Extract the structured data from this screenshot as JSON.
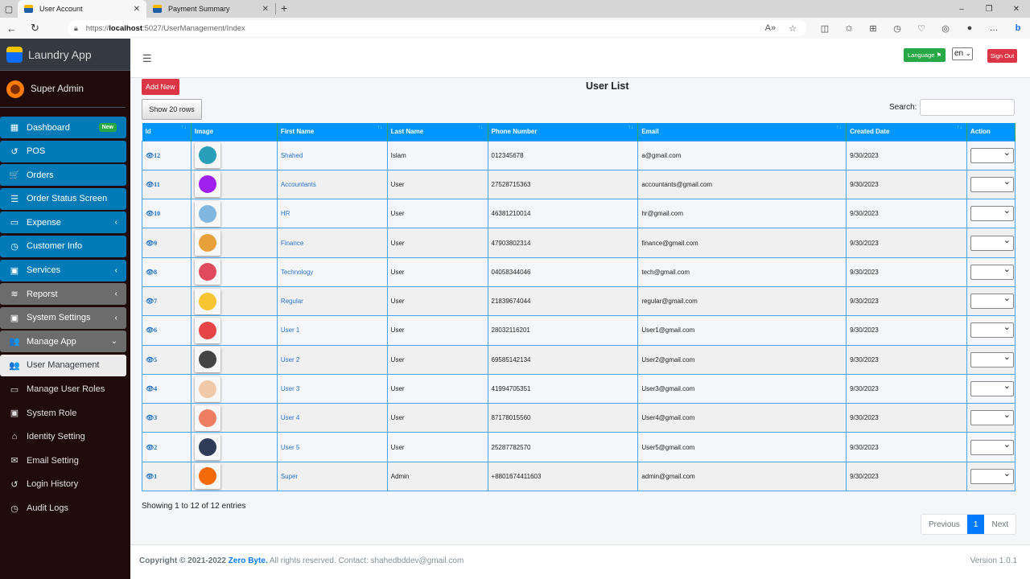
{
  "browser": {
    "tabs": [
      {
        "title": "User Account",
        "active": true
      },
      {
        "title": "Payment Summary",
        "active": false
      }
    ],
    "url_prefix": "https://",
    "url_host": "localhost",
    "url_rest": ":5027/UserManagement/Index"
  },
  "sidebar": {
    "brand": "Laundry App",
    "user": "Super Admin",
    "items": [
      {
        "label": "Dashboard",
        "icon": "th",
        "style": "blue",
        "badge": "New"
      },
      {
        "label": "POS",
        "icon": "↺",
        "style": "blue"
      },
      {
        "label": "Orders",
        "icon": "🛒",
        "style": "blue"
      },
      {
        "label": "Order Status Screen",
        "icon": "☰",
        "style": "blue"
      },
      {
        "label": "Expense",
        "icon": "▭",
        "style": "blue",
        "chevron": "‹"
      },
      {
        "label": "Customer Info",
        "icon": "◷",
        "style": "blue"
      },
      {
        "label": "Services",
        "icon": "▣",
        "style": "blue",
        "chevron": "‹"
      },
      {
        "label": "Reporst",
        "icon": "≋",
        "style": "gray",
        "chevron": "‹"
      },
      {
        "label": "System Settings",
        "icon": "▣",
        "style": "gray",
        "chevron": "‹"
      },
      {
        "label": "Manage App",
        "icon": "👥",
        "style": "gray",
        "chevron": "⌄"
      },
      {
        "label": "User Management",
        "icon": "👥",
        "style": "activew"
      },
      {
        "label": "Manage User Roles",
        "icon": "▭",
        "style": "plain"
      },
      {
        "label": "System Role",
        "icon": "▣",
        "style": "plain"
      },
      {
        "label": "Identity Setting",
        "icon": "⌂",
        "style": "plain"
      },
      {
        "label": "Email Setting",
        "icon": "✉",
        "style": "plain"
      },
      {
        "label": "Login History",
        "icon": "↺",
        "style": "plain"
      },
      {
        "label": "Audit Logs",
        "icon": "◷",
        "style": "plain"
      }
    ]
  },
  "topnav": {
    "language_label": "Language",
    "language_value": "en",
    "signout_label": "Sign Out"
  },
  "main": {
    "add_new_label": "Add New",
    "title": "User List",
    "show_rows_label": "Show 20 rows",
    "search_label": "Search:",
    "search_value": "",
    "columns": [
      "Id",
      "Image",
      "First Name",
      "Last Name",
      "Phone Number",
      "Email",
      "Created Date",
      "Action"
    ],
    "rows": [
      {
        "id": "12",
        "first": "Shahed",
        "last": "Islam",
        "phone": "012345678",
        "email": "a@gmail.com",
        "date": "9/30/2023",
        "color": "#2a9fb9"
      },
      {
        "id": "11",
        "first": "Accountants",
        "last": "User",
        "phone": "27528715363",
        "email": "accountants@gmail.com",
        "date": "9/30/2023",
        "color": "#a020f0"
      },
      {
        "id": "10",
        "first": "HR",
        "last": "User",
        "phone": "46381210014",
        "email": "hr@gmail.com",
        "date": "9/30/2023",
        "color": "#7fb7e0"
      },
      {
        "id": "9",
        "first": "Finance",
        "last": "User",
        "phone": "47903802314",
        "email": "finance@gmail.com",
        "date": "9/30/2023",
        "color": "#e8a13a"
      },
      {
        "id": "8",
        "first": "Technology",
        "last": "User",
        "phone": "04058344046",
        "email": "tech@gmail.com",
        "date": "9/30/2023",
        "color": "#e04a5f"
      },
      {
        "id": "7",
        "first": "Regular",
        "last": "User",
        "phone": "21839674044",
        "email": "regular@gmail.com",
        "date": "9/30/2023",
        "color": "#f7c531"
      },
      {
        "id": "6",
        "first": "User 1",
        "last": "User",
        "phone": "28032116201",
        "email": "User1@gmail.com",
        "date": "9/30/2023",
        "color": "#e64545"
      },
      {
        "id": "5",
        "first": "User 2",
        "last": "User",
        "phone": "69585142134",
        "email": "User2@gmail.com",
        "date": "9/30/2023",
        "color": "#444444"
      },
      {
        "id": "4",
        "first": "User 3",
        "last": "User",
        "phone": "41994705351",
        "email": "User3@gmail.com",
        "date": "9/30/2023",
        "color": "#f0c9a8"
      },
      {
        "id": "3",
        "first": "User 4",
        "last": "User",
        "phone": "87178015560",
        "email": "User4@gmail.com",
        "date": "9/30/2023",
        "color": "#f07d62"
      },
      {
        "id": "2",
        "first": "User 5",
        "last": "User",
        "phone": "25287782570",
        "email": "User5@gmail.com",
        "date": "9/30/2023",
        "color": "#2f3b57"
      },
      {
        "id": "1",
        "first": "Super",
        "last": "Admin",
        "phone": "+8801674411603",
        "email": "admin@gmail.com",
        "date": "9/30/2023",
        "color": "#f26a0a"
      }
    ],
    "showing_text": "Showing 1 to 12 of 12 entries",
    "pager": {
      "previous": "Previous",
      "current": "1",
      "next": "Next"
    }
  },
  "footer": {
    "copy_prefix": "Copyright © 2021-2022",
    "company": "Zero Byte.",
    "copy_suffix": "All rights reserved. Contact: shahedbddev@gmail.com",
    "version": "Version 1.0.1"
  }
}
